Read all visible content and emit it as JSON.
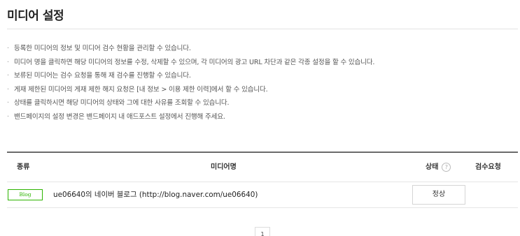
{
  "page": {
    "title": "미디어 설정"
  },
  "notices": [
    "등록한 미디어의 정보 및 미디어 검수 현황을 관리할 수 있습니다.",
    "미디어 명을 클릭하면 해당 미디어의 정보를 수정, 삭제할 수 있으며, 각 미디어의 광고 URL 차단과 같은 각종 설정을 할 수 있습니다.",
    "보류된 미디어는 검수 요청을 통해 재 검수를 진행할 수 있습니다.",
    "게재 제한된 미디어의 게재 제한 해지 요청은 [내 정보 > 이용 제한 이력]에서 할 수 있습니다.",
    "상태를 클릭하시면 해당 미디어의 상태와 그에 대한 사유를 조회할 수 있습니다.",
    "밴드페이지의 설정 변경은 밴드페이지 내 애드포스트 설정에서 진행해 주세요."
  ],
  "notice_bullet": "·",
  "table": {
    "headers": {
      "type": "종류",
      "name": "미디어명",
      "status": "상태",
      "review": "검수요청"
    },
    "status_help_icon": "?",
    "rows": [
      {
        "type_badge": "Blog",
        "media_name": "ue06640의 네이버 블로그 (http://blog.naver.com/ue06640)",
        "status": "정상",
        "review": ""
      }
    ]
  },
  "colors": {
    "blog_badge": "#2db400",
    "table_top_border": "#6b6b6b"
  },
  "icons": {
    "status_help": "question-circle-icon"
  },
  "pagination": {
    "current_page": "1"
  }
}
